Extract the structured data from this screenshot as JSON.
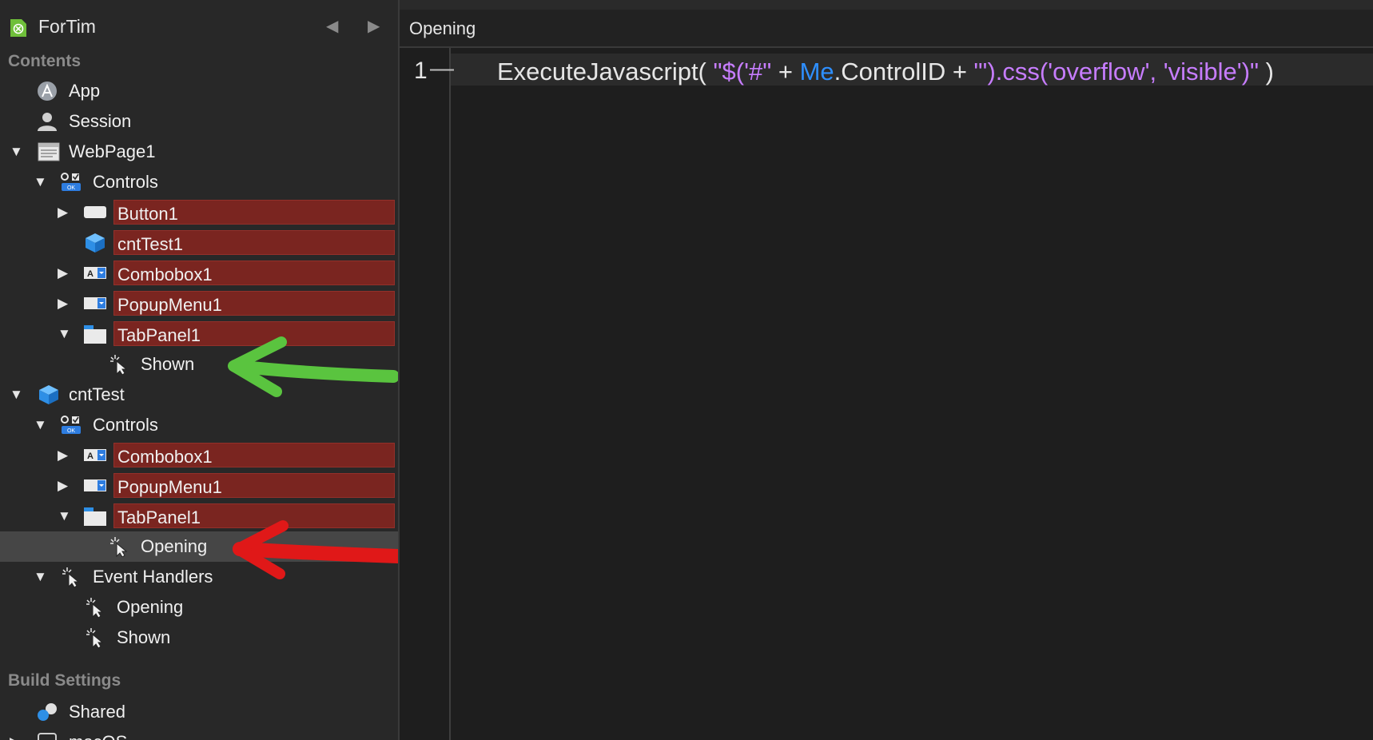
{
  "sidebar": {
    "project_title": "ForTim",
    "sections": {
      "contents": "Contents",
      "build_settings": "Build Settings"
    },
    "items": {
      "app": "App",
      "session": "Session",
      "webpage1": "WebPage1",
      "webpage_controls": "Controls",
      "button1": "Button1",
      "cnttest1": "cntTest1",
      "combobox1_a": "Combobox1",
      "popupmenu1_a": "PopupMenu1",
      "tabpanel1_a": "TabPanel1",
      "shown_a": "Shown",
      "cnttest": "cntTest",
      "cnttest_controls": "Controls",
      "combobox1_b": "Combobox1",
      "popupmenu1_b": "PopupMenu1",
      "tabpanel1_b": "TabPanel1",
      "opening_selected": "Opening",
      "event_handlers": "Event Handlers",
      "eh_opening": "Opening",
      "eh_shown": "Shown",
      "shared": "Shared",
      "macos": "macOS"
    }
  },
  "editor": {
    "tab_label": "Opening",
    "line_number": "1",
    "code": {
      "t1": "ExecuteJavascript( ",
      "t2": "\"$('#\"",
      "t3": " + ",
      "t4": "Me",
      "t5": ".ControlID + ",
      "t6": "\"').css('overflow', 'visible')\"",
      "t7": " )"
    }
  },
  "colors": {
    "highlight_red": "#7a2520",
    "string_purple": "#c77dff",
    "keyword_blue": "#2e8fff",
    "green_arrow": "#5ac43f",
    "red_arrow": "#e01818"
  }
}
